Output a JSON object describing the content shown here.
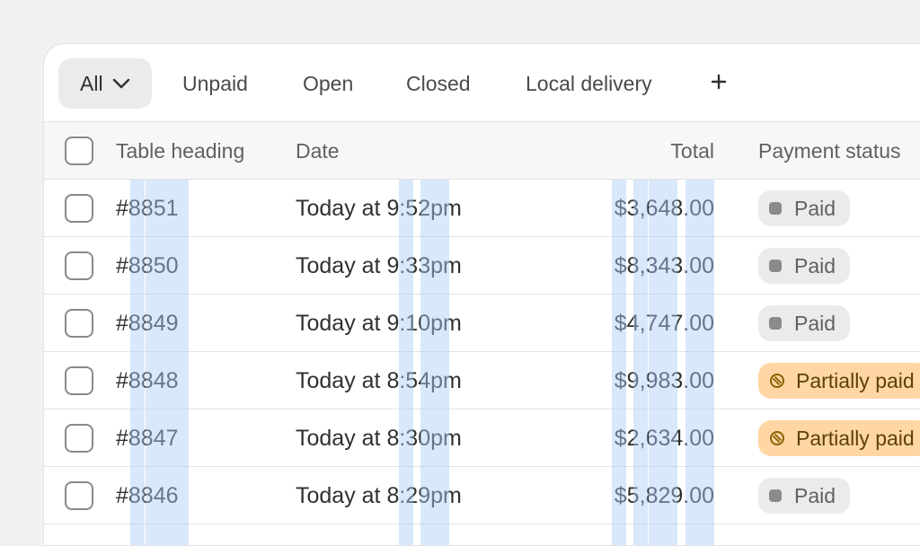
{
  "tabs": {
    "active_label": "All",
    "items": [
      "Unpaid",
      "Open",
      "Closed",
      "Local delivery"
    ],
    "add_label": "+"
  },
  "table": {
    "headers": {
      "heading": "Table heading",
      "date": "Date",
      "total": "Total",
      "payment_status": "Payment status"
    },
    "rows": [
      {
        "order": "#8851",
        "date": "Today at 9:52pm",
        "total": "$3,648.00",
        "status": "Paid",
        "status_type": "paid"
      },
      {
        "order": "#8850",
        "date": "Today at 9:33pm",
        "total": "$8,343.00",
        "status": "Paid",
        "status_type": "paid"
      },
      {
        "order": "#8849",
        "date": "Today at 9:10pm",
        "total": "$4,747.00",
        "status": "Paid",
        "status_type": "paid"
      },
      {
        "order": "#8848",
        "date": "Today at 8:54pm",
        "total": "$9,983.00",
        "status": "Partially paid",
        "status_type": "partial"
      },
      {
        "order": "#8847",
        "date": "Today at 8:30pm",
        "total": "$2,634.00",
        "status": "Partially paid",
        "status_type": "partial"
      },
      {
        "order": "#8846",
        "date": "Today at 8:29pm",
        "total": "$5,829.00",
        "status": "Paid",
        "status_type": "paid"
      }
    ]
  },
  "colors": {
    "paid_badge": "#ebebeb",
    "partial_badge": "#ffd6a4",
    "highlight": "#cfe3f9"
  },
  "icons": {
    "tab_dropdown": "chevron-down-icon",
    "add_tab": "plus-icon",
    "paid": "status-dot-icon",
    "partial": "partial-circle-icon"
  }
}
